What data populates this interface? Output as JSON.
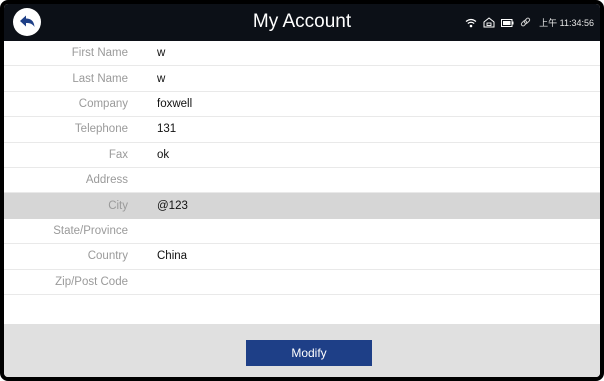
{
  "header": {
    "title": "My Account",
    "back_icon": "back-arrow-icon",
    "status": {
      "icons": [
        "wifi-icon",
        "home-icon",
        "battery-icon",
        "link-icon"
      ],
      "time": "上午 11:34:56"
    }
  },
  "form": {
    "fields": [
      {
        "label": "First Name",
        "value": "w"
      },
      {
        "label": "Last Name",
        "value": "w"
      },
      {
        "label": "Company",
        "value": "foxwell"
      },
      {
        "label": "Telephone",
        "value": "131"
      },
      {
        "label": "Fax",
        "value": "ok"
      },
      {
        "label": "Address",
        "value": ""
      },
      {
        "label": "City",
        "value": "@123",
        "selected": true
      },
      {
        "label": "State/Province",
        "value": ""
      },
      {
        "label": "Country",
        "value": "China"
      },
      {
        "label": "Zip/Post Code",
        "value": ""
      }
    ]
  },
  "footer": {
    "modify_label": "Modify"
  },
  "colors": {
    "topbar": "#0c1017",
    "selected_row": "#d6d6d6",
    "button": "#1e3f87",
    "footer": "#e0e0e0"
  }
}
